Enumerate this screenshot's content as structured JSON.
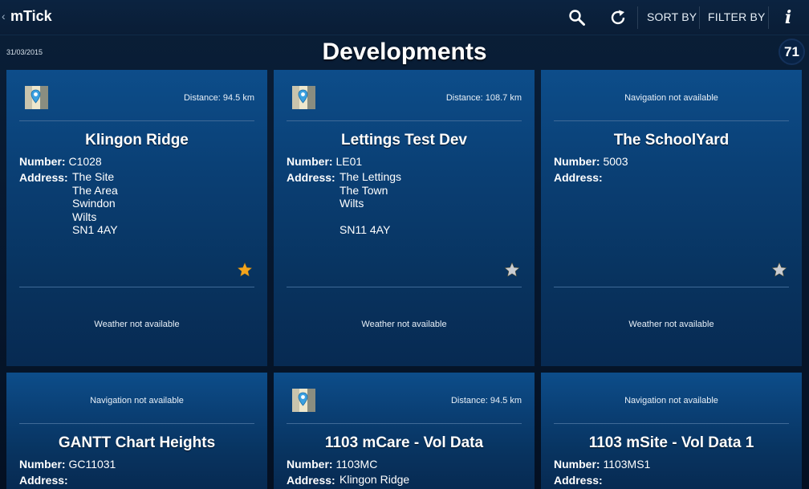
{
  "app": {
    "title": "mTick",
    "back_glyph": "‹",
    "actions": {
      "search_icon": "search-icon",
      "refresh_icon": "refresh-icon",
      "sort_label": "SORT BY",
      "filter_label": "FILTER BY",
      "info_glyph": "i"
    }
  },
  "header": {
    "date": "31/03/2015",
    "title": "Developments",
    "count": "71"
  },
  "colors": {
    "star_favorite": "#f4a41c",
    "star_default": "#c8ccd2",
    "card_top": "#0d4d8a",
    "card_bottom": "#072a52"
  },
  "cards": [
    {
      "distance": "Distance: 94.5 km",
      "has_map": true,
      "nav": "",
      "title": "Klingon Ridge",
      "number_label": "Number:",
      "number": "C1028",
      "address_label": "Address:",
      "address": [
        "The Site",
        "The Area",
        "Swindon",
        "Wilts",
        "SN1 4AY"
      ],
      "favorite": true,
      "weather": "Weather not available"
    },
    {
      "distance": "Distance: 108.7 km",
      "has_map": true,
      "nav": "",
      "title": "Lettings Test Dev",
      "number_label": "Number:",
      "number": "LE01",
      "address_label": "Address:",
      "address": [
        "The Lettings",
        "The Town",
        "Wilts",
        "",
        "SN11 4AY"
      ],
      "favorite": false,
      "weather": "Weather not available"
    },
    {
      "distance": "",
      "has_map": false,
      "nav": "Navigation not available",
      "title": "The SchoolYard",
      "number_label": "Number:",
      "number": "5003",
      "address_label": "Address:",
      "address": [],
      "favorite": false,
      "weather": "Weather not available"
    },
    {
      "distance": "",
      "has_map": false,
      "nav": "Navigation not available",
      "title": "GANTT Chart Heights",
      "number_label": "Number:",
      "number": "GC11031",
      "address_label": "Address:",
      "address": [],
      "favorite": false,
      "weather": ""
    },
    {
      "distance": "Distance: 94.5 km",
      "has_map": true,
      "nav": "",
      "title": "1103 mCare - Vol Data",
      "number_label": "Number:",
      "number": "1103MC",
      "address_label": "Address:",
      "address": [
        "Klingon Ridge"
      ],
      "favorite": false,
      "weather": ""
    },
    {
      "distance": "",
      "has_map": false,
      "nav": "Navigation not available",
      "title": "1103 mSite - Vol Data 1",
      "number_label": "Number:",
      "number": "1103MS1",
      "address_label": "Address:",
      "address": [],
      "favorite": false,
      "weather": ""
    }
  ]
}
